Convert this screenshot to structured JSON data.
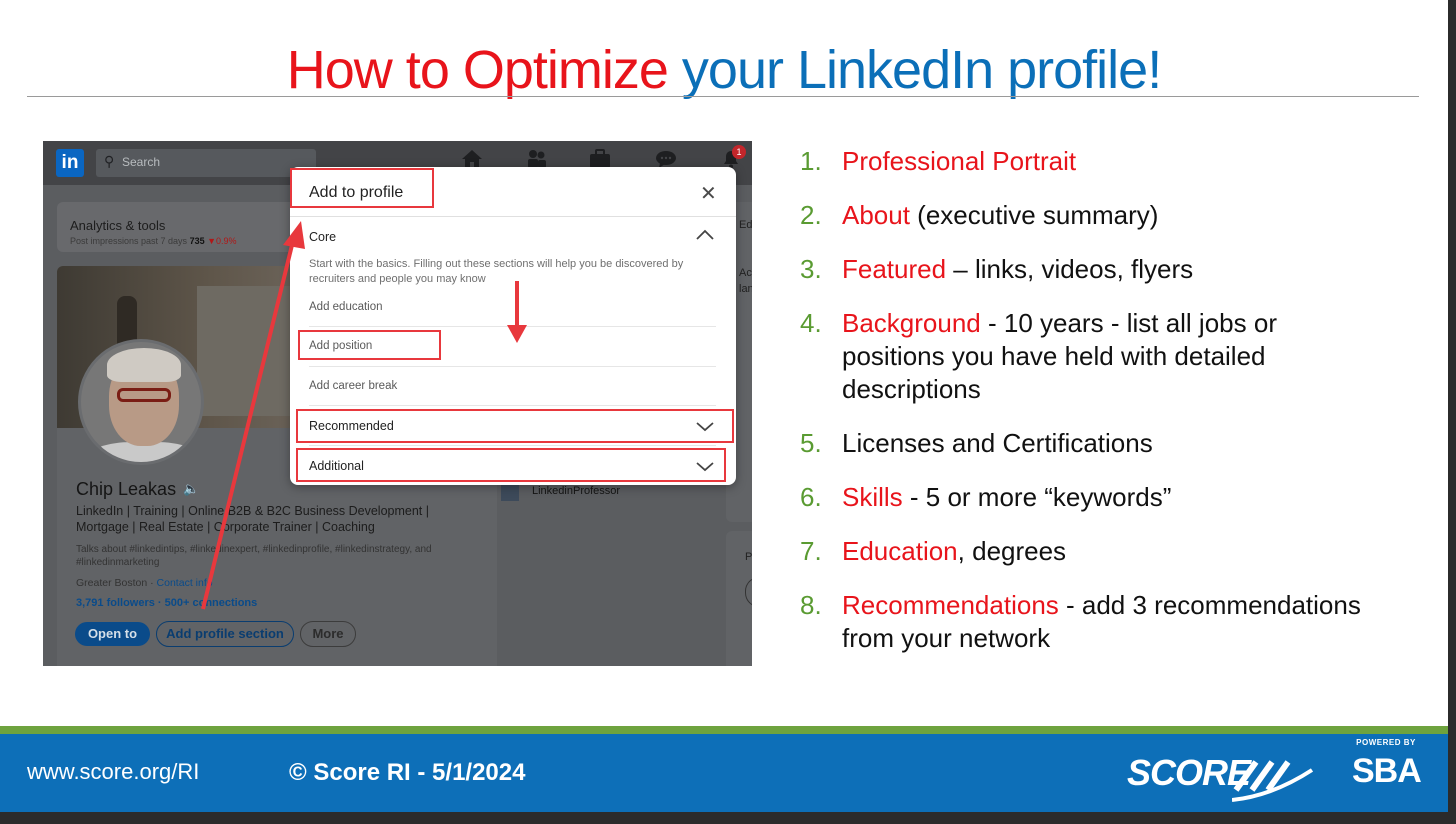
{
  "slide": {
    "title_part1": "How to Optimize",
    "title_part2": "your LinkedIn profile!"
  },
  "linkedin": {
    "logo": "in",
    "search_placeholder": "Search",
    "notification_count": "1",
    "analytics": {
      "title": "Analytics & tools",
      "subtitle": "Post impressions past 7 days",
      "value": "735",
      "change": "▼0.9%"
    },
    "profile": {
      "name": "Chip Leakas",
      "headline": "LinkedIn | Training | Online B2B & B2C Business Development | Mortgage | Real Estate | Corporate Trainer | Coaching",
      "talks_about": "Talks about #linkedintips, #linkedinexpert, #linkedinprofile, #linkedinstrategy, and #linkedinmarketing",
      "location": "Greater Boston ·",
      "contact_info": "Contact info",
      "followers": "3,791 followers · 500+ connections",
      "open_to_label": "Open to",
      "add_section_label": "Add profile section",
      "more_label": "More"
    },
    "side": {
      "text1": "Ed",
      "text2a": "Ac",
      "text2b": "lan",
      "text3": "P",
      "mini_profile": "LinkedinProfessor"
    },
    "modal": {
      "title": "Add to profile",
      "core_label": "Core",
      "core_description": "Start with the basics. Filling out these sections will help you be discovered by recruiters and people you may know",
      "items": [
        "Add education",
        "Add position",
        "Add career break"
      ],
      "sections": [
        "Recommended",
        "Additional"
      ]
    }
  },
  "tips": [
    {
      "num": "1.",
      "highlight": "Professional Portrait",
      "rest": ""
    },
    {
      "num": "2.",
      "highlight": "About",
      "rest": " (executive summary)"
    },
    {
      "num": "3.",
      "highlight": "Featured",
      "rest": " – links, videos, flyers"
    },
    {
      "num": "4.",
      "highlight": "Background",
      "rest": " - 10 years - list all jobs or positions you have held with detailed descriptions"
    },
    {
      "num": "5.",
      "highlight": "",
      "rest": "Licenses and Certifications"
    },
    {
      "num": "6.",
      "highlight": "Skills",
      "rest": " - 5 or more “keywords”"
    },
    {
      "num": "7.",
      "highlight": "Education",
      "rest": ", degrees"
    },
    {
      "num": "8.",
      "highlight": "Recommendations",
      "rest": " - add 3 recommendations from your network"
    }
  ],
  "footer": {
    "url": "www.score.org/RI",
    "copyright": "© Score RI - 5/1/2024",
    "score_logo": "SCORE",
    "sba_powered": "POWERED BY",
    "sba_logo": "SBA"
  },
  "colors": {
    "title_red": "#e8141b",
    "title_blue": "#0b6fb8",
    "number_green": "#5a9b32",
    "footer_blue": "#0d6fb8",
    "footer_green": "#6ea33e",
    "annotation_red": "#e8383d"
  }
}
